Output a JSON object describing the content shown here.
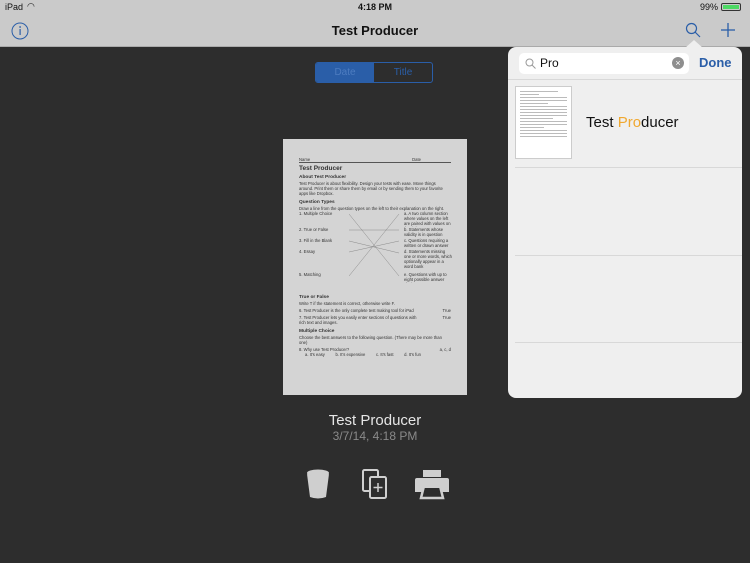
{
  "status": {
    "device": "iPad",
    "time": "4:18 PM",
    "battery": "99%",
    "battery_color": "#4cd964"
  },
  "nav": {
    "title": "Test Producer",
    "info_icon": "info-icon",
    "search_icon": "search-icon",
    "add_icon": "plus-icon"
  },
  "sort": {
    "options": [
      "Date",
      "Title"
    ],
    "selected": "Date"
  },
  "document": {
    "name_label": "Name",
    "date_label": "Date",
    "title": "Test Producer",
    "about_h": "About Test Producer",
    "about": "Test Producer is about flexibility. Design your tests with ease. Move things around. Print them or share them by email or by sending them to your favorite apps like Dropbox.",
    "qt_h": "Question Types",
    "qt_intro": "Draw a line from the question types on the left to their explanation on the right.",
    "left": [
      "1. Multiple Choice",
      "2. True or False",
      "3. Fill in the Blank",
      "4. Essay",
      "5. Matching"
    ],
    "right": [
      "a. A two column section where values on the left are paired with values on the right",
      "b. Statements whose validity is in question",
      "c. Questions requiring a written or drawn answer",
      "d. Statements missing one or more words, which optionally appear in a word bank",
      "e. Questions with up to eight possible answer choices"
    ],
    "tf_h": "True or False",
    "tf_intro": "Write T if the statement is correct, otherwise write F.",
    "tf": [
      {
        "q": "6. Test Producer is the only complete test making tool for iPad",
        "a": "True"
      },
      {
        "q": "7. Test Producer lets you easily enter sections of questions with rich text and images.",
        "a": "True"
      }
    ],
    "mc_h": "Multiple Choice",
    "mc_intro": "Choose the best answers to the following question. (There may be more than one)",
    "mc_q": "8. Why use Test Producer?",
    "mc_a": "a, c, d",
    "mc_choices": [
      "a. It's easy",
      "b. It's expensive",
      "c. It's fast",
      "d. It's fun"
    ]
  },
  "selected_doc": {
    "title": "Test Producer",
    "date": "3/7/14, 4:18 PM"
  },
  "actions": [
    {
      "icon": "trash-icon"
    },
    {
      "icon": "duplicate-icon"
    },
    {
      "icon": "print-icon"
    }
  ],
  "popover": {
    "search_value": "Pro",
    "done": "Done",
    "results": [
      {
        "before": "Test ",
        "match": "Pro",
        "after": "ducer"
      }
    ],
    "highlight_color": "#f0a830"
  }
}
